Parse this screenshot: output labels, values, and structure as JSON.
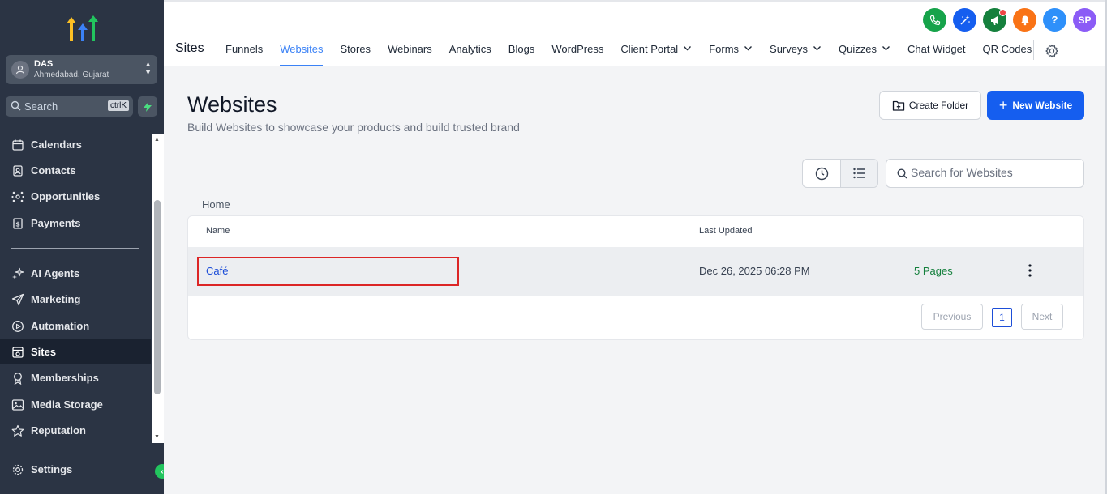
{
  "sidebar": {
    "location": {
      "name": "DAS",
      "subtitle": "Ahmedabad, Gujarat"
    },
    "search": {
      "label": "Search",
      "shortcut": "ctrlK"
    },
    "items_top": [
      {
        "label": "Calendars",
        "icon": "calendar-icon"
      },
      {
        "label": "Contacts",
        "icon": "contacts-icon"
      },
      {
        "label": "Opportunities",
        "icon": "opportunities-icon"
      },
      {
        "label": "Payments",
        "icon": "payments-icon"
      }
    ],
    "items_bottom": [
      {
        "label": "AI Agents",
        "icon": "sparkle-icon"
      },
      {
        "label": "Marketing",
        "icon": "send-icon"
      },
      {
        "label": "Automation",
        "icon": "automation-icon"
      },
      {
        "label": "Sites",
        "icon": "sites-icon",
        "active": true
      },
      {
        "label": "Memberships",
        "icon": "membership-icon"
      },
      {
        "label": "Media Storage",
        "icon": "image-icon"
      },
      {
        "label": "Reputation",
        "icon": "star-icon"
      }
    ],
    "settings_label": "Settings"
  },
  "topbar": {
    "section": "Sites",
    "tabs": [
      "Funnels",
      "Websites",
      "Stores",
      "Webinars",
      "Analytics",
      "Blogs",
      "WordPress",
      "Client Portal",
      "Forms",
      "Surveys",
      "Quizzes",
      "Chat Widget",
      "QR Codes"
    ],
    "active_tab": "Websites",
    "avatar_initials": "SP",
    "help_label": "?",
    "icon_colors": {
      "phone": "#16a34a",
      "magic": "#155eef",
      "announce": "#15803d",
      "bell": "#f97316",
      "help": "#2e90fa",
      "avatar": "#8b5cf6"
    }
  },
  "main": {
    "title": "Websites",
    "subtitle": "Build Websites to showcase your products and build trusted brand",
    "create_folder": "Create Folder",
    "new_website": "New Website",
    "search_placeholder": "Search for Websites",
    "breadcrumb": "Home",
    "columns": {
      "name": "Name",
      "last_updated": "Last Updated"
    },
    "rows": [
      {
        "name": "Café",
        "last_updated": "Dec 26, 2025 06:28 PM",
        "pages": "5 Pages"
      }
    ],
    "pagination": {
      "previous": "Previous",
      "current": "1",
      "next": "Next"
    }
  }
}
